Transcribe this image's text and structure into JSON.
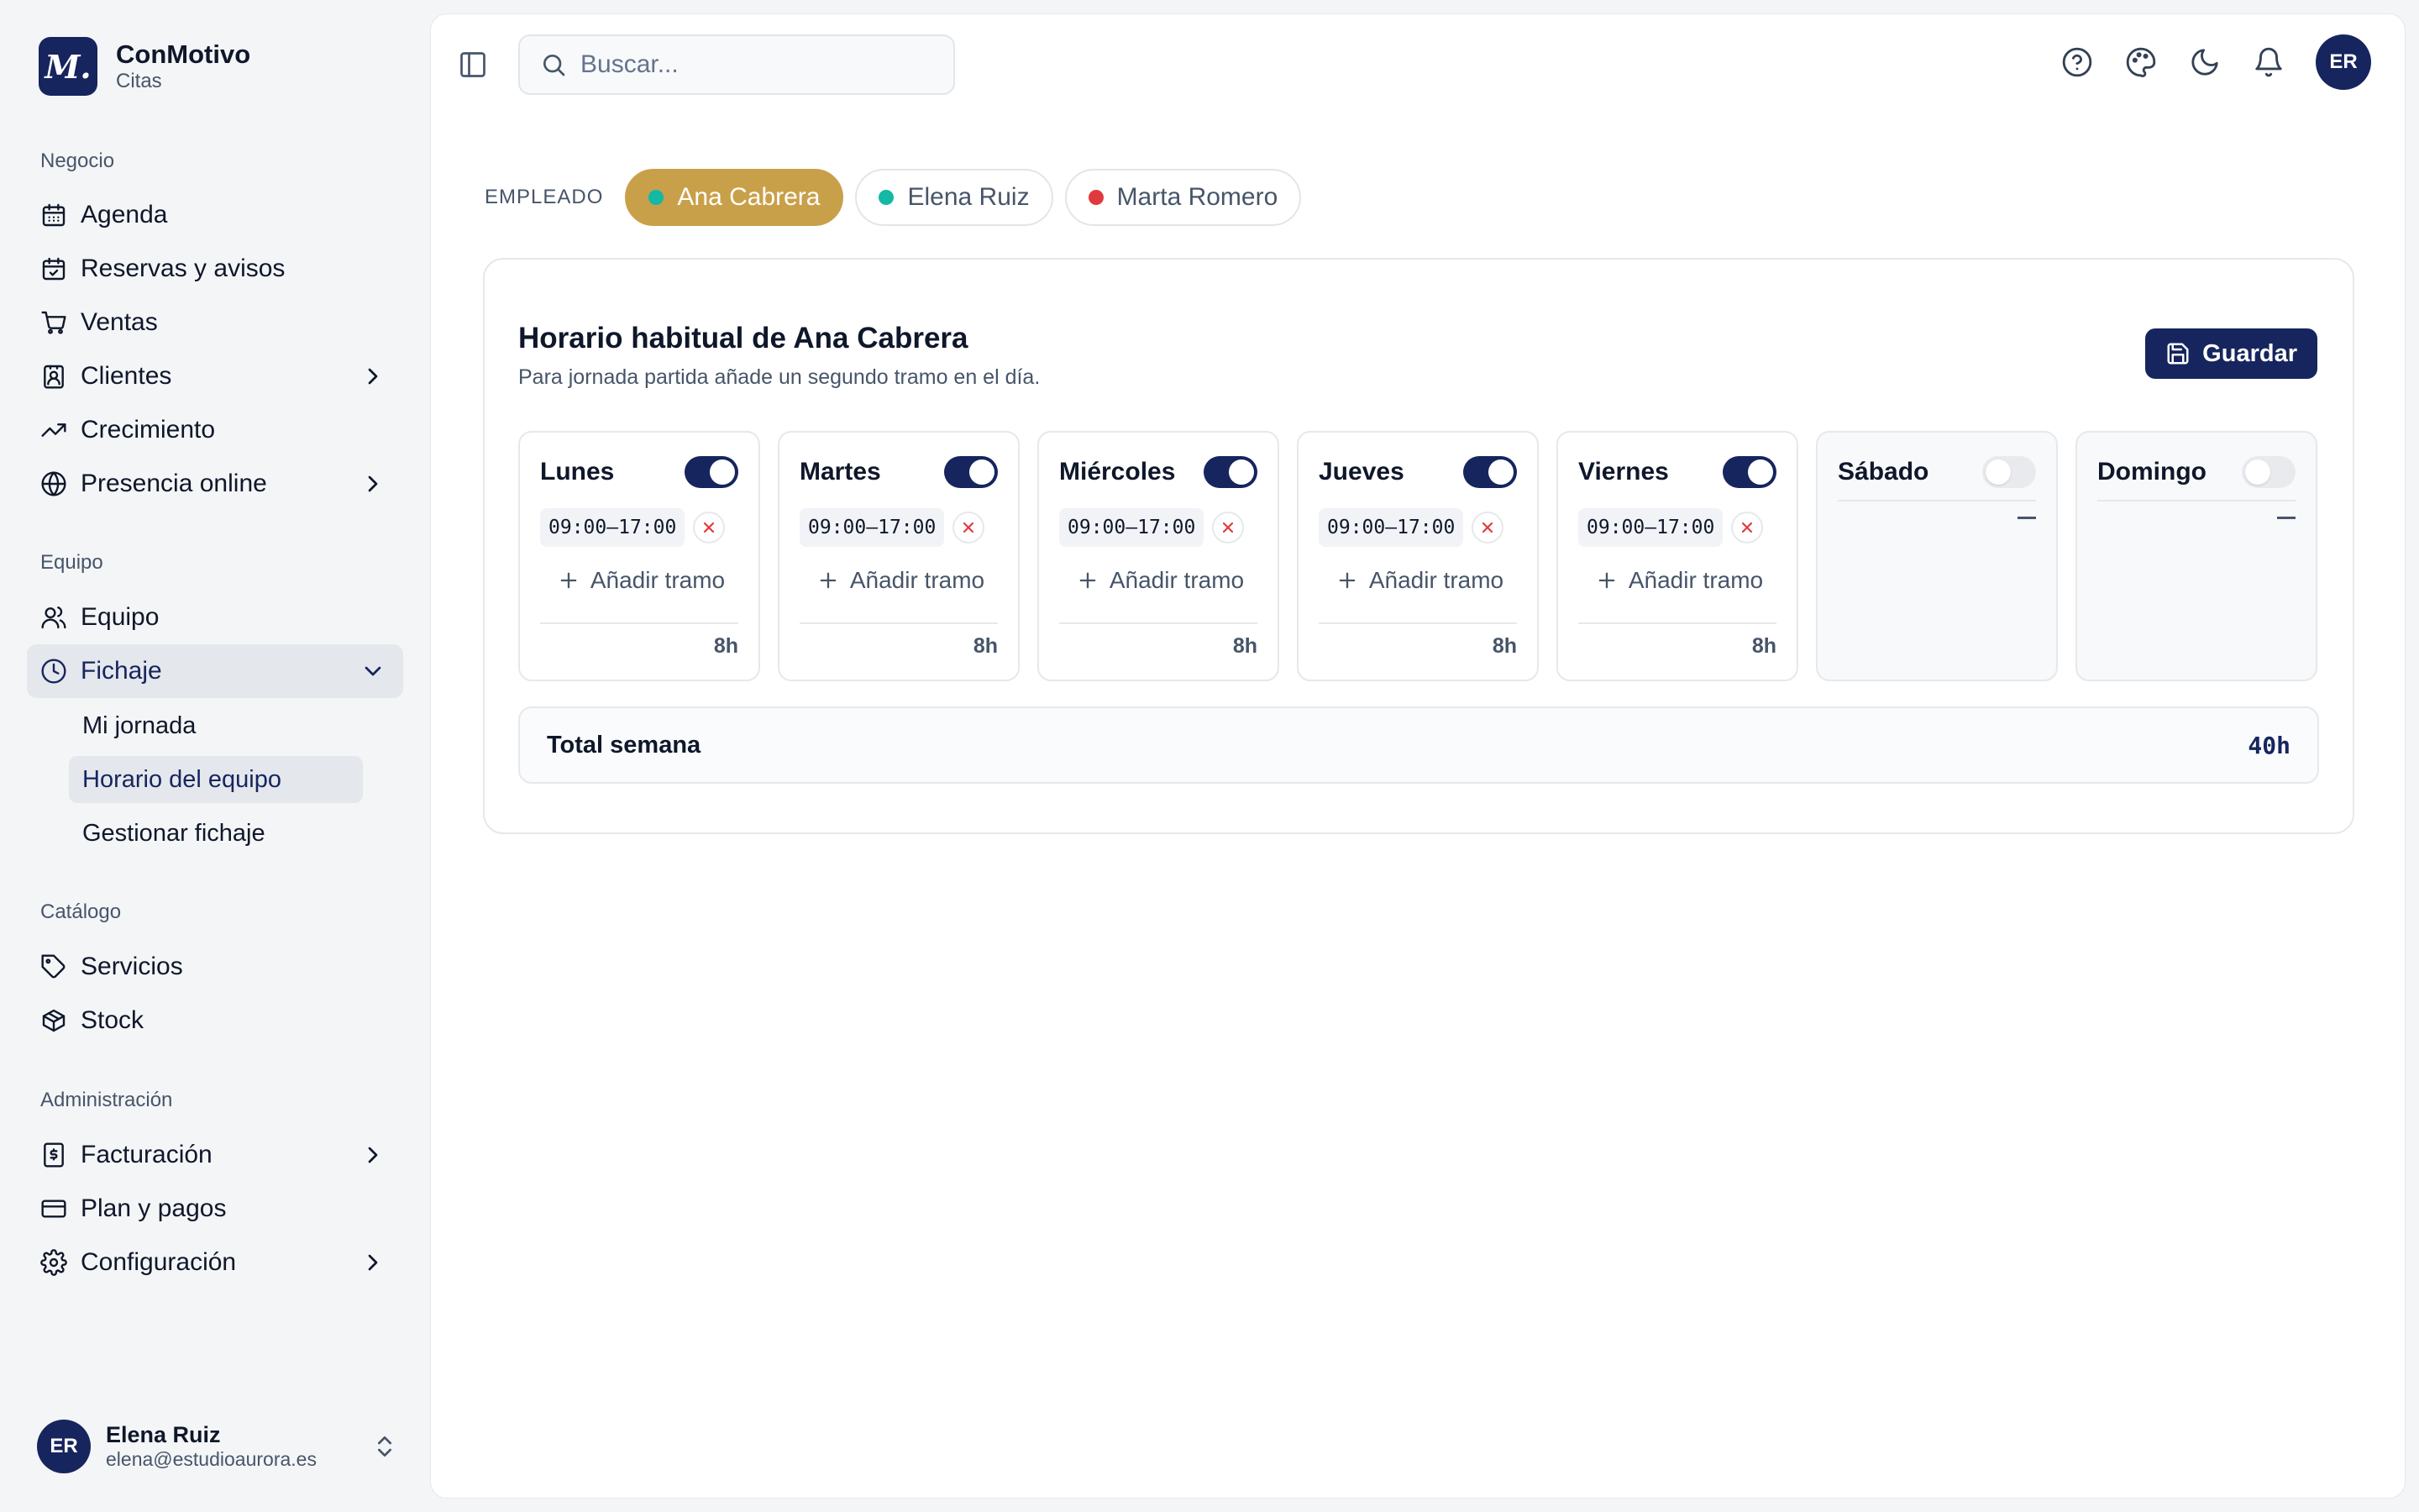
{
  "brand": {
    "logo_letter": "M.",
    "name": "ConMotivo",
    "sub": "Citas"
  },
  "sidebar": {
    "sections": [
      {
        "title": "Negocio",
        "items": [
          {
            "label": "Agenda",
            "icon": "calendar-icon"
          },
          {
            "label": "Reservas y avisos",
            "icon": "calendar-check-icon"
          },
          {
            "label": "Ventas",
            "icon": "cart-icon"
          },
          {
            "label": "Clientes",
            "icon": "contact-icon",
            "chevron": true
          },
          {
            "label": "Crecimiento",
            "icon": "trending-icon"
          },
          {
            "label": "Presencia online",
            "icon": "globe-icon",
            "chevron": true
          }
        ]
      },
      {
        "title": "Equipo",
        "items": [
          {
            "label": "Equipo",
            "icon": "users-icon"
          },
          {
            "label": "Fichaje",
            "icon": "clock-icon",
            "expanded": true,
            "active": true,
            "sub": [
              {
                "label": "Mi jornada"
              },
              {
                "label": "Horario del equipo",
                "active": true
              },
              {
                "label": "Gestionar fichaje"
              }
            ]
          }
        ]
      },
      {
        "title": "Catálogo",
        "items": [
          {
            "label": "Servicios",
            "icon": "tag-icon"
          },
          {
            "label": "Stock",
            "icon": "box-icon"
          }
        ]
      },
      {
        "title": "Administración",
        "items": [
          {
            "label": "Facturación",
            "icon": "invoice-icon",
            "chevron": true
          },
          {
            "label": "Plan y pagos",
            "icon": "credit-card-icon"
          },
          {
            "label": "Configuración",
            "icon": "gear-icon",
            "chevron": true
          }
        ]
      }
    ]
  },
  "user": {
    "initials": "ER",
    "name": "Elena Ruiz",
    "email": "elena@estudioaurora.es"
  },
  "topbar": {
    "search_placeholder": "Buscar...",
    "avatar_initials": "ER"
  },
  "employees": {
    "label": "EMPLEADO",
    "list": [
      {
        "name": "Ana Cabrera",
        "dot_color": "#14b8a6",
        "selected": true
      },
      {
        "name": "Elena Ruiz",
        "dot_color": "#14b8a6",
        "selected": false
      },
      {
        "name": "Marta Romero",
        "dot_color": "#e03a3e",
        "selected": false
      }
    ]
  },
  "schedule": {
    "title": "Horario habitual de Ana Cabrera",
    "subtitle": "Para jornada partida añade un segundo tramo en el día.",
    "save_label": "Guardar",
    "add_slot_label": "Añadir tramo",
    "days": [
      {
        "name": "Lunes",
        "enabled": true,
        "start": "09:00",
        "end": "17:00",
        "hours": "8h"
      },
      {
        "name": "Martes",
        "enabled": true,
        "start": "09:00",
        "end": "17:00",
        "hours": "8h"
      },
      {
        "name": "Miércoles",
        "enabled": true,
        "start": "09:00",
        "end": "17:00",
        "hours": "8h"
      },
      {
        "name": "Jueves",
        "enabled": true,
        "start": "09:00",
        "end": "17:00",
        "hours": "8h"
      },
      {
        "name": "Viernes",
        "enabled": true,
        "start": "09:00",
        "end": "17:00",
        "hours": "8h"
      },
      {
        "name": "Sábado",
        "enabled": false
      },
      {
        "name": "Domingo",
        "enabled": false
      }
    ],
    "total_label": "Total semana",
    "total_value": "40h"
  },
  "colors": {
    "brand": "#16255e",
    "accent_gold": "#c9a04a",
    "danger": "#e03a3e"
  }
}
